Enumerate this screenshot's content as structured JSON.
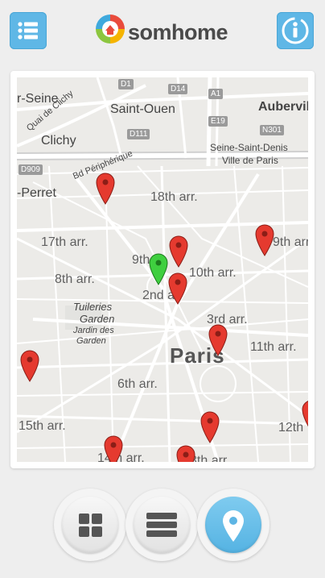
{
  "header": {
    "menu_icon": "list-menu-icon",
    "info_icon": "info-icon",
    "logo_text": "somhome",
    "accent": "#5fb7e6"
  },
  "map": {
    "labels": {
      "seine": "r-Seine",
      "saint_ouen": "Saint-Ouen",
      "aubervilliers": "Aubervill",
      "clichy": "Clichy",
      "quai": "Quai de Clichy",
      "bd_peripherique": "Bd Périphérique",
      "saint_denis_1": "Seine-Saint-Denis",
      "saint_denis_2": "Ville de Paris",
      "perret": "-Perret",
      "d909": "D909",
      "d1": "D1",
      "d14": "D14",
      "a1": "A1",
      "d111": "D111",
      "e19": "E19",
      "n301": "N301",
      "arr_18": "18th arr.",
      "arr_17": "17th arr.",
      "arr_19": "9th arr",
      "arr_9": "9th",
      "arr_10": "10th arr.",
      "arr_8": "8th arr.",
      "arr_2": "2nd ar",
      "arr_3": "3rd arr.",
      "arr_11": "11th arr.",
      "tuileries_1": "Tuileries",
      "tuileries_2": "Garden",
      "jardin_1": "Jardin des",
      "jardin_2": "Tuileries",
      "paris": "Paris",
      "arr_6": "6th arr.",
      "arr_15": "15th arr.",
      "arr_12": "12th",
      "arr_14": "14th arr.",
      "arr_13": "3th arr."
    },
    "pins": [
      {
        "color": "red"
      },
      {
        "color": "red"
      },
      {
        "color": "red"
      },
      {
        "color": "green"
      },
      {
        "color": "red"
      },
      {
        "color": "red"
      },
      {
        "color": "red"
      },
      {
        "color": "red"
      },
      {
        "color": "red"
      },
      {
        "color": "red"
      },
      {
        "color": "red"
      }
    ]
  },
  "bottom_nav": [
    {
      "name": "grid-view-button",
      "icon": "grid-icon",
      "active": false
    },
    {
      "name": "list-view-button",
      "icon": "list-icon",
      "active": false
    },
    {
      "name": "map-view-button",
      "icon": "location-pin-icon",
      "active": true
    }
  ]
}
